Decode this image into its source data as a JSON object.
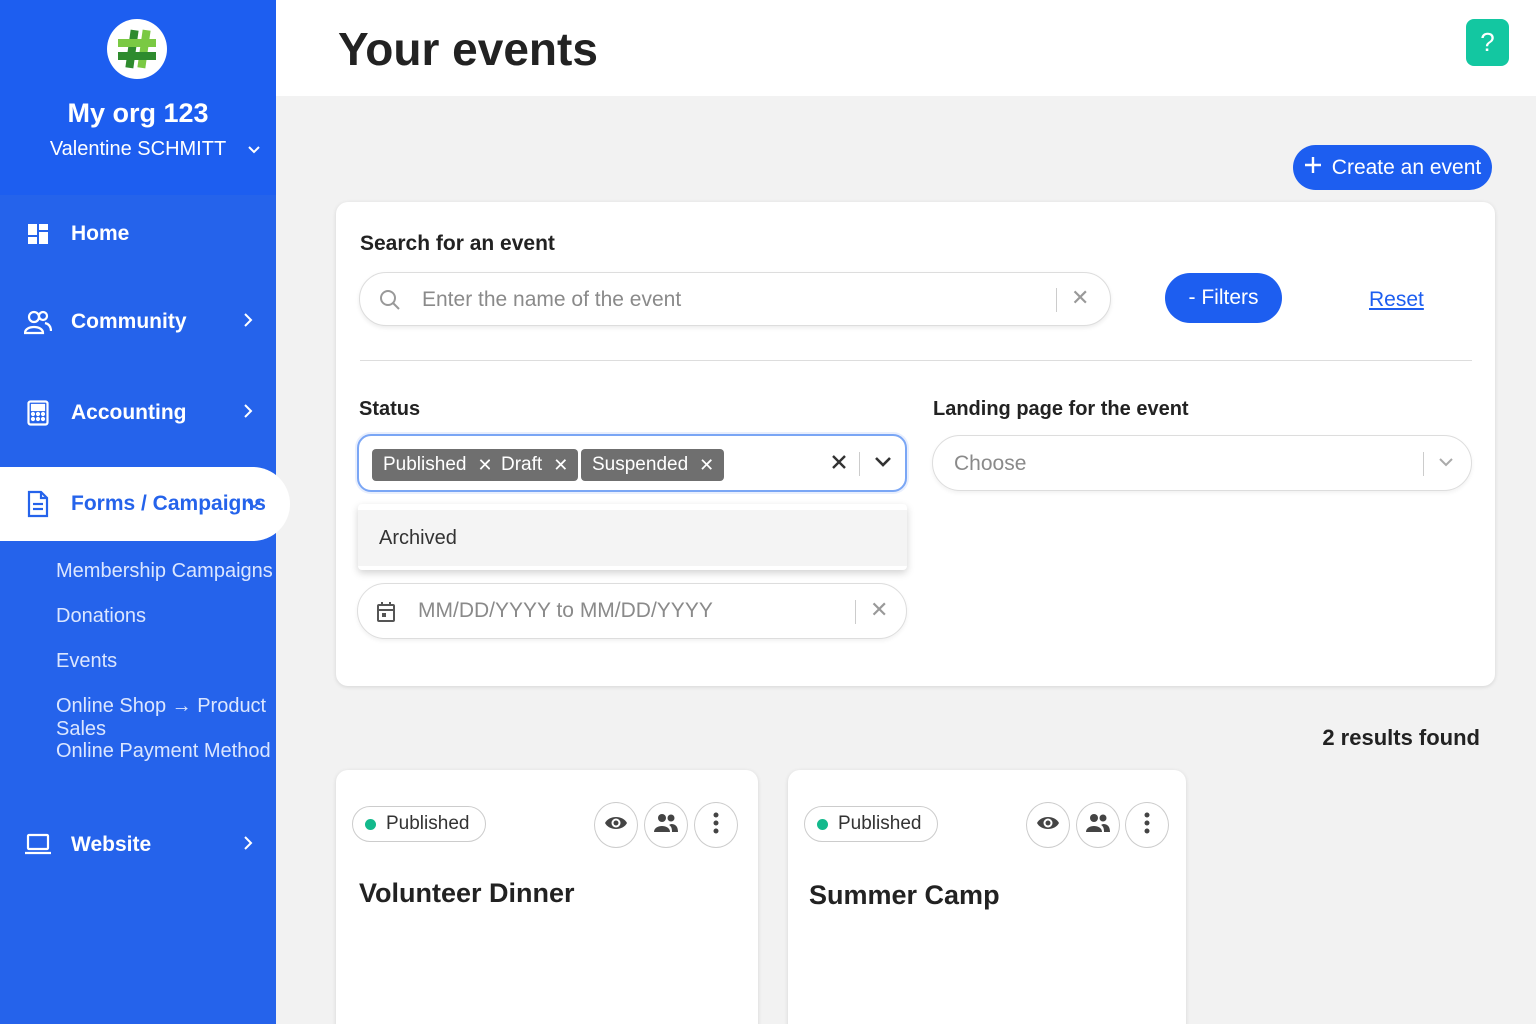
{
  "sidebar": {
    "org_name": "My org 123",
    "user_name": "Valentine SCHMITT",
    "nav": {
      "home": "Home",
      "community": "Community",
      "accounting": "Accounting",
      "forms": "Forms / Campaigns",
      "website": "Website"
    },
    "sub_items": [
      "Membership Campaigns",
      "Donations",
      "Events",
      "Online Shop → Product Sales",
      "Online Payment Method"
    ],
    "accent_color": "#2563eb"
  },
  "header": {
    "title": "Your events",
    "help_label": "?"
  },
  "actions": {
    "create_label": "Create an event"
  },
  "search": {
    "label": "Search for an event",
    "placeholder": "Enter the name of the event",
    "filters_label": "- Filters",
    "reset_label": "Reset"
  },
  "filters": {
    "status_label": "Status",
    "status_chips": [
      "Published",
      "Draft",
      "Suspended"
    ],
    "status_options": [
      "Archived"
    ],
    "landing_label": "Landing page for the event",
    "landing_placeholder": "Choose",
    "date_placeholder": "MM/DD/YYYY to MM/DD/YYYY"
  },
  "results": {
    "count_text": "2 results found"
  },
  "events": [
    {
      "status": "Published",
      "title": "Volunteer Dinner"
    },
    {
      "status": "Published",
      "title": "Summer Camp"
    }
  ]
}
